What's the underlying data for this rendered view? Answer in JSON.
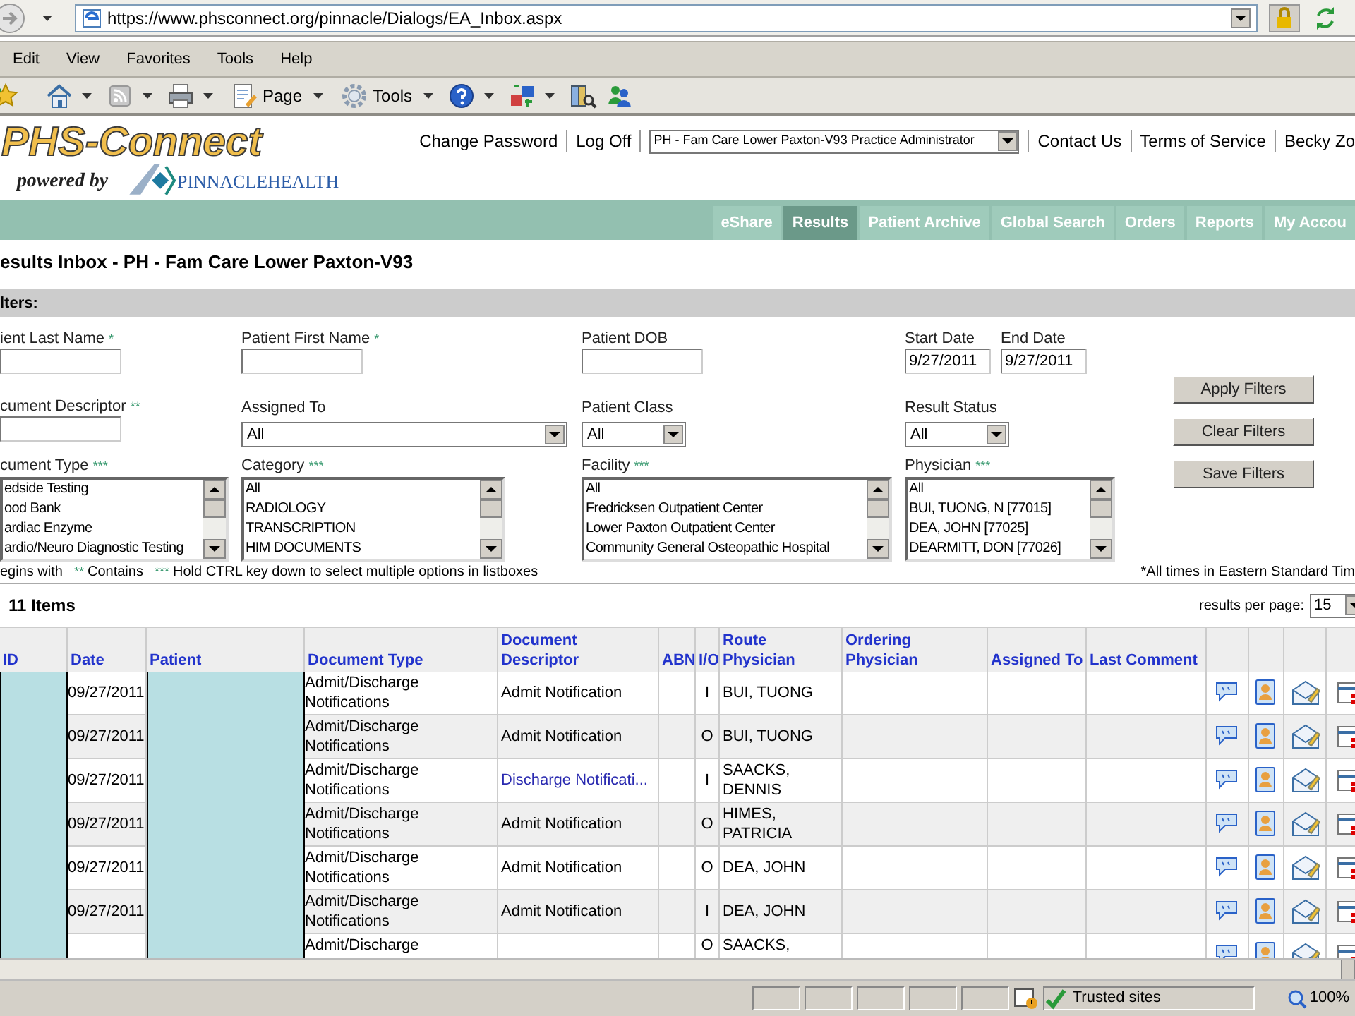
{
  "browser": {
    "url": "https://www.phsconnect.org/pinnacle/Dialogs/EA_Inbox.aspx",
    "menu": [
      "Edit",
      "View",
      "Favorites",
      "Tools",
      "Help"
    ],
    "commands": [
      {
        "kind": "add-favorite",
        "dropdown": false
      },
      {
        "kind": "home",
        "dropdown": true
      },
      {
        "kind": "feeds",
        "dropdown": true
      },
      {
        "kind": "print",
        "dropdown": true
      },
      {
        "kind": "page",
        "label": "Page",
        "dropdown": true
      },
      {
        "kind": "tools",
        "label": "Tools",
        "dropdown": true
      },
      {
        "kind": "help",
        "dropdown": true
      },
      {
        "kind": "translate",
        "dropdown": true
      },
      {
        "kind": "research",
        "dropdown": false
      },
      {
        "kind": "messenger",
        "dropdown": false
      }
    ]
  },
  "header": {
    "logo_title": "PHS-Connect",
    "logo_tagline": "powered by",
    "logo_brand": "PINNACLEHEALTH",
    "links_left": [
      "Change Password",
      "Log Off"
    ],
    "practice_select": "PH - Fam Care Lower Paxton-V93 Practice Administrator",
    "links_right": [
      "Contact Us",
      "Terms of Service",
      "Becky Zo"
    ]
  },
  "nav_tabs": [
    {
      "label": "eShare",
      "selected": false
    },
    {
      "label": "Results",
      "selected": true
    },
    {
      "label": "Patient Archive",
      "selected": false
    },
    {
      "label": "Global Search",
      "selected": false
    },
    {
      "label": "Orders",
      "selected": false
    },
    {
      "label": "Reports",
      "selected": false
    },
    {
      "label": "My Accou",
      "selected": false
    }
  ],
  "page_title": "esults Inbox - PH - Fam Care Lower Paxton-V93",
  "filters": {
    "heading": "lters:",
    "rows": [
      [
        {
          "kind": "text",
          "label": "ient Last Name",
          "marker": "*"
        },
        {
          "kind": "text",
          "label": "Patient First Name",
          "marker": "*"
        },
        {
          "kind": "text",
          "label": "Patient DOB"
        },
        {
          "kind": "pair",
          "fields": [
            {
              "kind": "date",
              "label": "Start Date",
              "value": "9/27/2011"
            },
            {
              "kind": "date",
              "label": "End Date",
              "value": "9/27/2011"
            }
          ]
        }
      ],
      [
        {
          "kind": "text",
          "label": "cument Descriptor",
          "marker": "**"
        },
        {
          "kind": "select",
          "label": "Assigned To",
          "value": "All"
        },
        {
          "kind": "select",
          "label": "Patient Class",
          "value": "All"
        },
        {
          "kind": "select",
          "label": "Result Status",
          "value": "All"
        }
      ],
      [
        {
          "kind": "listbox",
          "label": "cument Type",
          "marker": "***",
          "options": [
            "edside Testing",
            "ood Bank",
            "ardiac Enzyme",
            "ardio/Neuro Diagnostic Testing"
          ]
        },
        {
          "kind": "listbox",
          "label": "Category",
          "marker": "***",
          "options": [
            "All",
            "RADIOLOGY",
            "TRANSCRIPTION",
            "HIM DOCUMENTS"
          ]
        },
        {
          "kind": "listbox",
          "label": "Facility",
          "marker": "***",
          "options": [
            "All",
            "Fredricksen Outpatient Center",
            "Lower Paxton Outpatient Center",
            "Community General Osteopathic Hospital"
          ]
        },
        {
          "kind": "listbox",
          "label": "Physician",
          "marker": "***",
          "options": [
            "All",
            "BUI, TUONG, N [77015]",
            "DEA, JOHN [77025]",
            "DEARMITT, DON [77026]"
          ]
        }
      ]
    ],
    "buttons": [
      "Apply Filters",
      "Clear Filters",
      "Save Filters"
    ],
    "hints": [
      {
        "text": "egins with"
      },
      {
        "marker": "**",
        "text": "Contains"
      },
      {
        "marker": "***",
        "text": "Hold CTRL key down to select multiple options in listboxes"
      }
    ],
    "timezone_note": "*All times in Eastern Standard Tim"
  },
  "results": {
    "count": "11 Items",
    "per_page_label": "results per page:",
    "per_page_value": "15"
  },
  "table": {
    "columns": [
      "ID",
      "Date",
      "Patient",
      "Document Type",
      "Document Descriptor",
      "ABN",
      "I/O",
      "Route Physician",
      "Ordering Physician",
      "Assigned To",
      "Last Comment"
    ],
    "rows": [
      {
        "date": "09/27/2011",
        "document_type": "Admit/Discharge Notifications",
        "descriptor": "Admit Notification",
        "link": false,
        "io": "I",
        "route_physician": "BUI, TUONG"
      },
      {
        "date": "09/27/2011",
        "document_type": "Admit/Discharge Notifications",
        "descriptor": "Admit Notification",
        "link": false,
        "io": "O",
        "route_physician": "BUI, TUONG"
      },
      {
        "date": "09/27/2011",
        "document_type": "Admit/Discharge Notifications",
        "descriptor": "Discharge Notificati...",
        "link": true,
        "io": "I",
        "route_physician": "SAACKS, DENNIS"
      },
      {
        "date": "09/27/2011",
        "document_type": "Admit/Discharge Notifications",
        "descriptor": "Admit Notification",
        "link": false,
        "io": "O",
        "route_physician": "HIMES, PATRICIA"
      },
      {
        "date": "09/27/2011",
        "document_type": "Admit/Discharge Notifications",
        "descriptor": "Admit Notification",
        "link": false,
        "io": "O",
        "route_physician": "DEA, JOHN"
      },
      {
        "date": "09/27/2011",
        "document_type": "Admit/Discharge Notifications",
        "descriptor": "Admit Notification",
        "link": false,
        "io": "I",
        "route_physician": "DEA, JOHN"
      },
      {
        "document_type": "Admit/Discharge",
        "io": "O",
        "route_physician": "SAACKS,"
      }
    ]
  },
  "status_bar": {
    "zone": "Trusted sites",
    "zoom": "100%"
  }
}
